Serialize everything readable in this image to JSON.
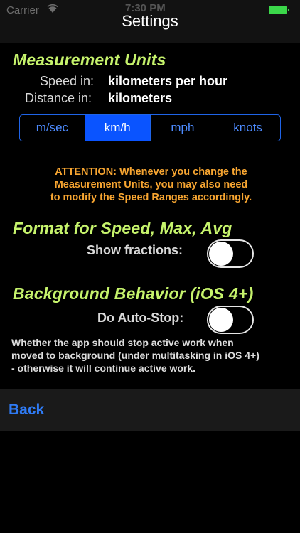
{
  "status_bar": {
    "carrier": "Carrier",
    "time": "7:30 PM"
  },
  "nav": {
    "title": "Settings"
  },
  "units": {
    "title": "Measurement Units",
    "speed_label": "Speed in:",
    "speed_value": "kilometers per hour",
    "distance_label": "Distance in:",
    "distance_value": "kilometers",
    "segments": [
      "m/sec",
      "km/h",
      "mph",
      "knots"
    ],
    "selected_index": 1
  },
  "attention": {
    "line1": "ATTENTION:  Whenever you change the",
    "line2": "Measurement Units, you may also need",
    "line3": "to modify the Speed Ranges accordingly."
  },
  "format": {
    "title": "Format for Speed, Max, Avg",
    "fractions_label": "Show fractions:",
    "fractions_on": false
  },
  "background": {
    "title": "Background Behavior (iOS 4+)",
    "autostop_label": "Do Auto-Stop:",
    "autostop_on": false,
    "desc_line1": "Whether the app should stop active work when",
    "desc_line2": "moved to background (under multitasking in iOS 4+)",
    "desc_line3": "- otherwise it will continue active work."
  },
  "footer": {
    "back_label": "Back"
  },
  "colors": {
    "accent_green": "#c6f36c",
    "accent_orange": "#f7a531",
    "ios_blue": "#0a54ff",
    "battery_green": "#3bd74a"
  }
}
